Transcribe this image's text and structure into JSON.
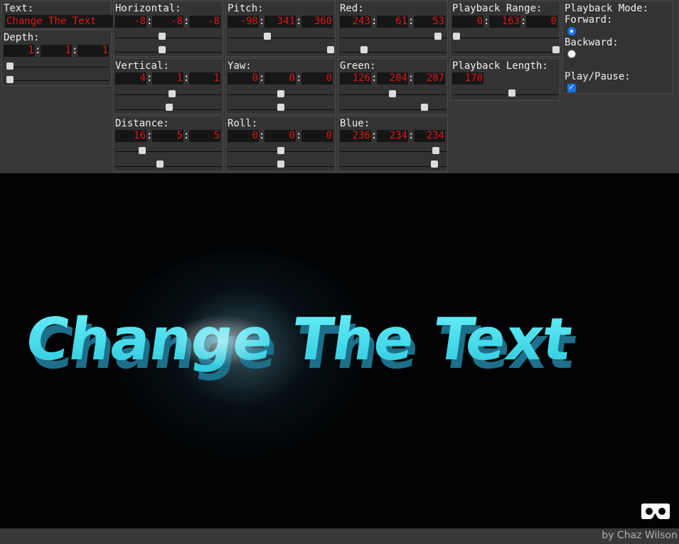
{
  "text_group": {
    "label": "Text:",
    "value": "Change The Text"
  },
  "depth": {
    "label": "Depth:",
    "values": [
      "1",
      "1",
      "1"
    ]
  },
  "horizontal": {
    "label": "Horizontal:",
    "values": [
      "-8",
      "-8",
      "-8"
    ]
  },
  "vertical": {
    "label": "Vertical:",
    "values": [
      "4",
      "1",
      "1"
    ]
  },
  "distance": {
    "label": "Distance:",
    "values": [
      "16",
      "5",
      "5"
    ]
  },
  "pitch": {
    "label": "Pitch:",
    "values": [
      "-98",
      "341",
      "360"
    ]
  },
  "yaw": {
    "label": "Yaw:",
    "values": [
      "0",
      "0",
      "0"
    ]
  },
  "roll": {
    "label": "Roll:",
    "values": [
      "0",
      "0",
      "0"
    ]
  },
  "red": {
    "label": "Red:",
    "values": [
      "243",
      "61",
      "53"
    ]
  },
  "green": {
    "label": "Green:",
    "values": [
      "126",
      "204",
      "207"
    ]
  },
  "blue": {
    "label": "Blue:",
    "values": [
      "236",
      "234",
      "234"
    ]
  },
  "playback_range": {
    "label": "Playback Range:",
    "values": [
      "0",
      "163",
      "0"
    ]
  },
  "playback_length": {
    "label": "Playback Length:",
    "value": "170"
  },
  "playback_mode": {
    "label": "Playback Mode:",
    "forward": "Forward:",
    "backward": "Backward:",
    "selected": "forward"
  },
  "play_pause": {
    "label": "Play/Pause:",
    "checked": true
  },
  "scene": {
    "rendered_text": "Change The Text",
    "text_color": "#49e3f0"
  },
  "footer": {
    "credit": "by Chaz Wilson"
  },
  "colors": {
    "panel_bg": "#383838",
    "input_bg": "#161616",
    "number_text": "#e0161a",
    "accent": "#1a73e8"
  }
}
